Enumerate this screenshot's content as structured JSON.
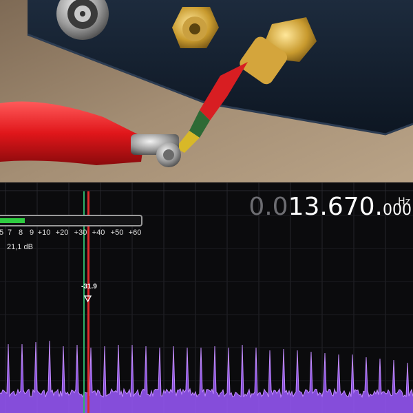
{
  "frequency": {
    "dim_prefix": "0.0",
    "main": "13.670.",
    "sub": "000",
    "unit": "Hz"
  },
  "smeter": {
    "level_fraction": 0.2,
    "scale_labels": [
      "5",
      "7",
      "8",
      "9",
      "+10",
      "+20",
      "+30",
      "+40",
      "+50",
      "+60"
    ],
    "signal_readout": "21,1 dB"
  },
  "marker": {
    "label": "-31.9"
  },
  "colors": {
    "spectrum": "#9b59ff",
    "smeter_fill": "#2ecc40",
    "marker_red": "#e02a2a",
    "marker_green": "#2db36b"
  }
}
